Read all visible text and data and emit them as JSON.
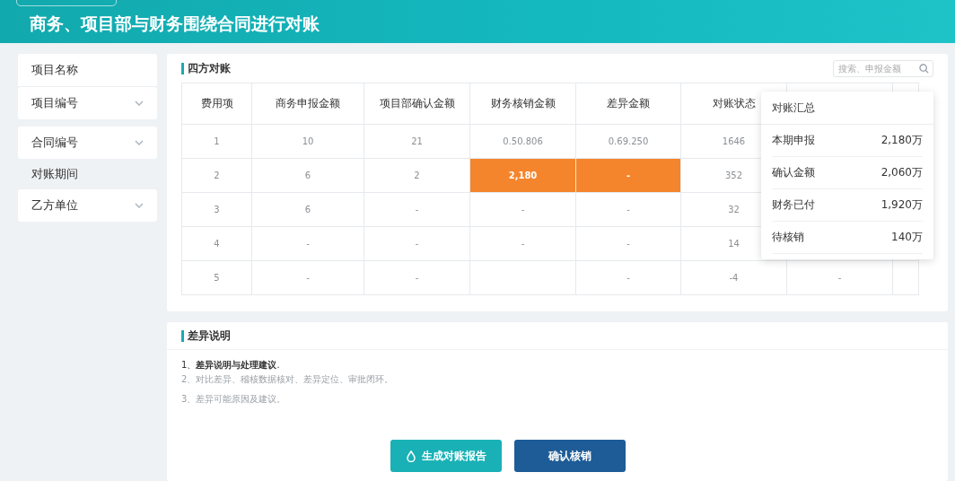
{
  "header": {
    "title": "商务、项目部与财务围绕合同进行对账"
  },
  "sidebar": {
    "items": [
      {
        "label": "项目名称",
        "kind": "field",
        "dropdown": false
      },
      {
        "label": "项目编号",
        "kind": "field",
        "dropdown": true
      },
      {
        "label": "合同编号",
        "kind": "field",
        "dropdown": true
      },
      {
        "label": "对账期间",
        "kind": "label"
      },
      {
        "label": "乙方单位",
        "kind": "field",
        "dropdown": true
      }
    ]
  },
  "reconciliation": {
    "title": "四方对账",
    "search": {
      "placeholder": "搜索、申报金额"
    },
    "columns": [
      "费用项",
      "商务申报金额",
      "项目部确认金额",
      "财务核销金额",
      "差异金额",
      "对账状态"
    ],
    "rows": [
      {
        "cells": [
          {
            "text": "1",
            "highlighted": false
          },
          {
            "text": "10",
            "highlighted": false
          },
          {
            "text": "21",
            "highlighted": false
          },
          {
            "text": "0.50.806",
            "highlighted": false
          },
          {
            "text": "0.69.250",
            "highlighted": false
          },
          {
            "text": "1646",
            "highlighted": false
          }
        ]
      },
      {
        "cells": [
          {
            "text": "2",
            "highlighted": false
          },
          {
            "text": "6",
            "highlighted": false
          },
          {
            "text": "2",
            "highlighted": false
          },
          {
            "text": "2,180",
            "highlighted": true
          },
          {
            "text": "-",
            "highlighted": true
          },
          {
            "text": "352",
            "highlighted": false
          }
        ]
      },
      {
        "cells": [
          {
            "text": "3",
            "highlighted": false
          },
          {
            "text": "6",
            "highlighted": false
          },
          {
            "text": "-",
            "highlighted": false
          },
          {
            "text": "-",
            "highlighted": false
          },
          {
            "text": "-",
            "highlighted": false
          },
          {
            "text": "32",
            "highlighted": false
          }
        ]
      },
      {
        "cells": [
          {
            "text": "4",
            "highlighted": false
          },
          {
            "text": "-",
            "highlighted": false
          },
          {
            "text": "-",
            "highlighted": false
          },
          {
            "text": "-",
            "highlighted": false
          },
          {
            "text": "-",
            "highlighted": false
          },
          {
            "text": "14",
            "highlighted": false
          }
        ]
      },
      {
        "cells": [
          {
            "text": "5",
            "highlighted": false
          },
          {
            "text": "-",
            "highlighted": false
          },
          {
            "text": "-",
            "highlighted": false
          },
          {
            "text": null,
            "highlighted": false
          },
          {
            "text": "-",
            "highlighted": false
          },
          {
            "text": "-4",
            "highlighted": false
          }
        ],
        "column_7": "-"
      }
    ],
    "summary": {
      "title": "对账汇总",
      "items": [
        {
          "label": "本期申报",
          "value": "2,180万"
        },
        {
          "label": "确认金额",
          "value": "2,060万"
        },
        {
          "label": "财务已付",
          "value": "1,920万"
        },
        {
          "label": "待核销",
          "value": "140万"
        }
      ]
    }
  },
  "differences": {
    "title": "差异说明",
    "lines": [
      {
        "text": "1、**差异说明与处理建议**.",
        "muted": false
      },
      {
        "text": "2、对比差异、稽核数据核对、差异定位、审批闭环。",
        "muted": true
      },
      {
        "text": "3、差异可能原因及建议。",
        "muted": true
      }
    ]
  },
  "buttons": [
    {
      "label": "生成对账报告",
      "kind": "secondary"
    },
    {
      "label": "确认核销",
      "kind": "primary"
    }
  ]
}
